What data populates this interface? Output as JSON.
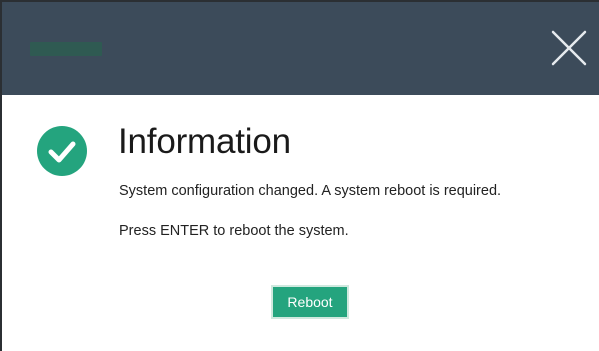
{
  "window": {
    "close_icon": "close-icon"
  },
  "dialog": {
    "icon": "check-circle-icon",
    "title": "Information",
    "message_line1": "System configuration changed. A system reboot is required.",
    "message_line2": "Press ENTER to reboot the system.",
    "button_label": "Reboot"
  },
  "colors": {
    "titlebar": "#3c4b5a",
    "accent": "#24a47e",
    "background": "#ffffff"
  }
}
